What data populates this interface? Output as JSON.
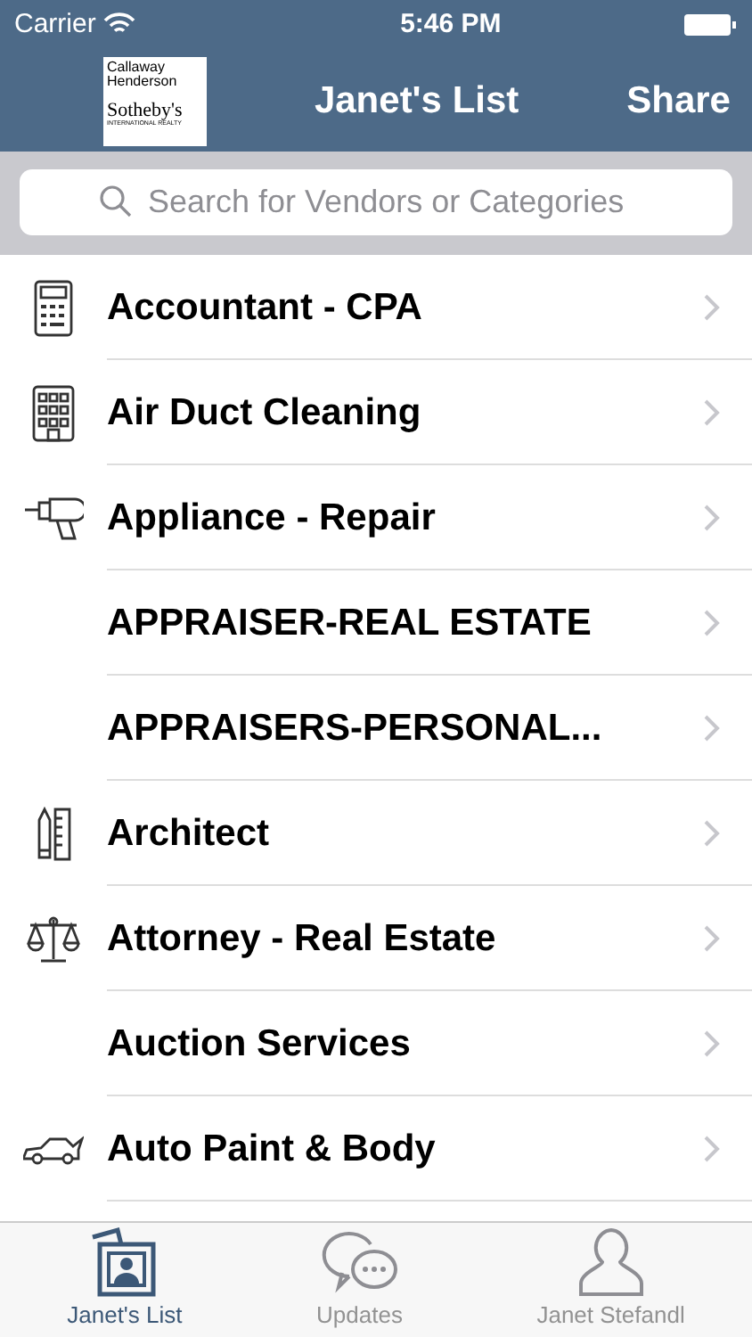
{
  "status_bar": {
    "carrier": "Carrier",
    "time": "5:46 PM"
  },
  "nav_bar": {
    "logo": {
      "line_1": "Callaway",
      "line_2": "Henderson",
      "line_3": "Sotheby's",
      "line_4": "INTERNATIONAL REALTY"
    },
    "title": "Janet's List",
    "action": "Share"
  },
  "search": {
    "placeholder": "Search for Vendors or Categories"
  },
  "categories": [
    {
      "label": "Accountant - CPA",
      "kind": "calculator"
    },
    {
      "label": "Air Duct Cleaning",
      "kind": "building"
    },
    {
      "label": "Appliance - Repair",
      "kind": "drill"
    },
    {
      "label": "APPRAISER-REAL ESTATE",
      "kind": "plain"
    },
    {
      "label": "APPRAISERS-PERSONAL...",
      "kind": "plain"
    },
    {
      "label": "Architect",
      "kind": "pencil"
    },
    {
      "label": "Attorney - Real Estate",
      "kind": "scales"
    },
    {
      "label": "Auction Services",
      "kind": "plain"
    },
    {
      "label": "Auto Paint & Body",
      "kind": "car"
    }
  ],
  "tab_bar": [
    {
      "label": "Janet's List",
      "selected": true
    },
    {
      "label": "Updates",
      "selected": false
    },
    {
      "label": "Janet Stefandl",
      "selected": false
    }
  ]
}
